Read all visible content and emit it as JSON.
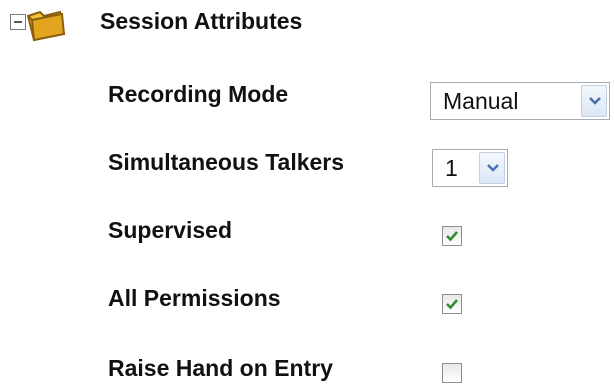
{
  "section": {
    "title": "Session Attributes",
    "expanded": true,
    "icon": "folder-icon",
    "toggle_icon": "collapse-minus-icon"
  },
  "fields": {
    "recording_mode": {
      "label": "Recording Mode",
      "value": "Manual"
    },
    "simultaneous_talkers": {
      "label": "Simultaneous Talkers",
      "value": "1"
    },
    "supervised": {
      "label": "Supervised",
      "checked": true
    },
    "all_permissions": {
      "label": "All Permissions",
      "checked": true
    },
    "raise_hand_on_entry": {
      "label": "Raise Hand on Entry",
      "checked": false
    }
  },
  "colors": {
    "check": "#2e8b2e",
    "arrow": "#4a6fb0",
    "folder": "#e8b530"
  }
}
